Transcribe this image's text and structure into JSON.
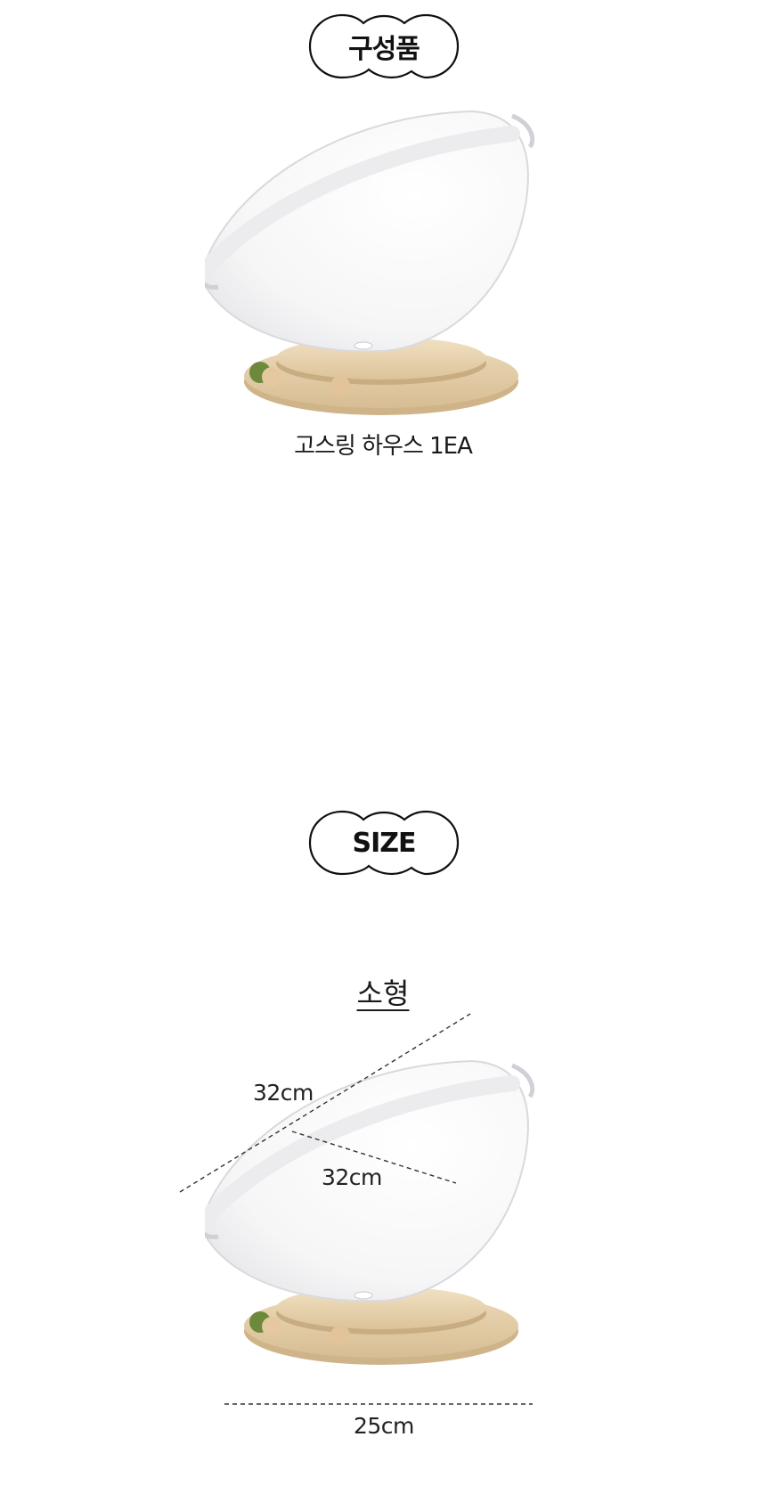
{
  "components_section": {
    "badge_label": "구성품",
    "caption": "고스링 하우스 1EA"
  },
  "size_section": {
    "badge_label": "SIZE",
    "model_title": "소형",
    "dimensions": {
      "diagonal": "32cm",
      "depth": "32cm",
      "base_width": "25cm"
    }
  }
}
